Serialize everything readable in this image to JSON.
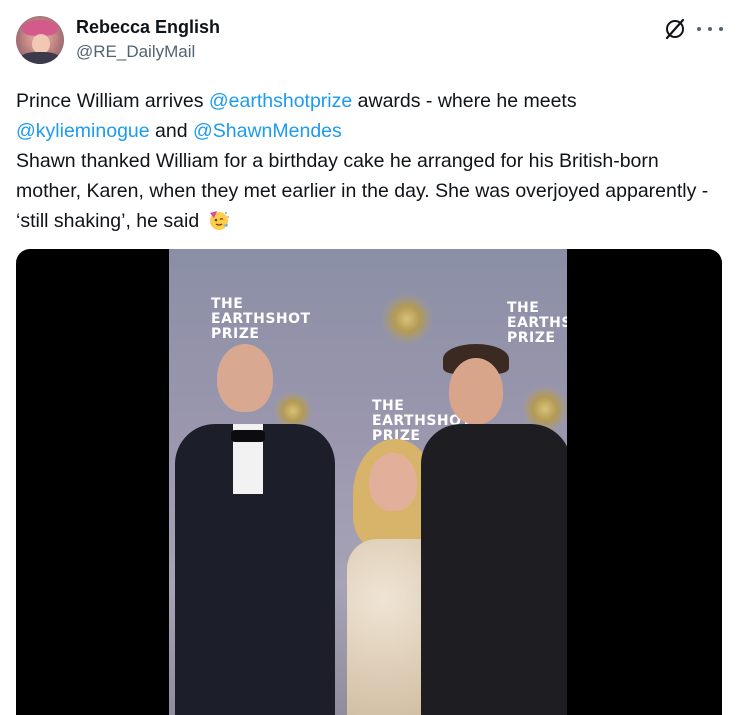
{
  "tweet": {
    "author": {
      "display_name": "Rebecca English",
      "handle": "@RE_DailyMail"
    },
    "text": {
      "line1_prefix": "Prince William arrives ",
      "mention1": "@earthshotprize",
      "line1_suffix": " awards - where he meets",
      "mention2": "@kylieminogue",
      "and_text": " and ",
      "mention3": "@ShawnMendes",
      "paragraph2": "Shawn thanked William for a birthday cake he arranged for his British-born mother, Karen, when they met earlier in the day. She was overjoyed apparently - ‘still shaking’, he said"
    },
    "icons": {
      "grok": "grok-icon",
      "more": "more-icon",
      "emoji": "party-face-emoji"
    },
    "media": {
      "backdrop_logo_lines": [
        "THE",
        "EARTHSHOT",
        "PRIZE"
      ],
      "backdrop_logo_right_lines": [
        "THE",
        "EARTHSH",
        "PRIZE"
      ]
    },
    "colors": {
      "mention": "#1d9bf0",
      "text": "#0f1419",
      "secondary": "#536471"
    }
  }
}
